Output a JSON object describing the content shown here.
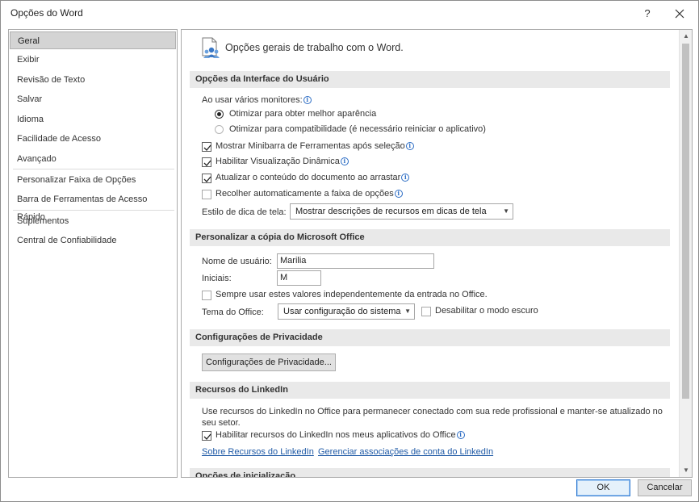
{
  "window": {
    "title": "Opções do Word",
    "help_label": "?",
    "close_icon": "close-icon"
  },
  "sidebar": {
    "items": [
      {
        "label": "Geral",
        "selected": true
      },
      {
        "label": "Exibir"
      },
      {
        "label": "Revisão de Texto"
      },
      {
        "label": "Salvar"
      },
      {
        "label": "Idioma"
      },
      {
        "label": "Facilidade de Acesso"
      },
      {
        "label": "Avançado"
      },
      {
        "label": "Personalizar Faixa de Opções"
      },
      {
        "label": "Barra de Ferramentas de Acesso Rápido"
      },
      {
        "label": "Suplementos"
      },
      {
        "label": "Central de Confiabilidade"
      }
    ]
  },
  "header": {
    "icon": "general-options-icon",
    "text": "Opções gerais de trabalho com o Word."
  },
  "ui_options": {
    "title": "Opções da Interface do Usuário",
    "monitors_label": "Ao usar vários monitores:",
    "radio_best": "Otimizar para obter melhor aparência",
    "radio_compat": "Otimizar para compatibilidade (é necessário reiniciar o aplicativo)",
    "check_minibar": "Mostrar Minibarra de Ferramentas após seleção",
    "check_live_preview": "Habilitar Visualização Dinâmica",
    "check_update_drag": "Atualizar o conteúdo do documento ao arrastar",
    "check_collapse_ribbon": "Recolher automaticamente a faixa de opções",
    "screentip_label": "Estilo de dica de tela:",
    "screentip_value": "Mostrar descrições de recursos em dicas de tela"
  },
  "personalize": {
    "title": "Personalizar a cópia do Microsoft Office",
    "username_label": "Nome de usuário:",
    "username_value": "Marilia",
    "initials_label": "Iniciais:",
    "initials_value": "M",
    "always_use_label": "Sempre usar estes valores independentemente da entrada no Office.",
    "theme_label": "Tema do Office:",
    "theme_value": "Usar configuração do sistema",
    "dark_mode_label": "Desabilitar o modo escuro"
  },
  "privacy": {
    "title": "Configurações de Privacidade",
    "button_label": "Configurações de Privacidade..."
  },
  "linkedin": {
    "title": "Recursos do LinkedIn",
    "description": "Use recursos do LinkedIn no Office para permanecer conectado com sua rede profissional e manter-se atualizado no seu setor.",
    "enable_label": "Habilitar recursos do LinkedIn nos meus aplicativos do Office",
    "link_about": "Sobre Recursos do LinkedIn",
    "link_manage": "Gerenciar associações de conta do LinkedIn"
  },
  "startup": {
    "title": "Opções de inicialização"
  },
  "footer": {
    "ok_label": "OK",
    "cancel_label": "Cancelar"
  },
  "colors": {
    "section_band": "#e9e9e9",
    "link": "#1f5aa6",
    "ok_border": "#2f7ad1",
    "info_icon": "#2b6cc4"
  }
}
